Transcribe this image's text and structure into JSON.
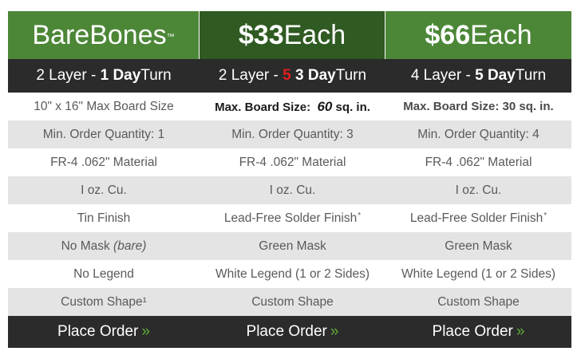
{
  "plans": [
    {
      "header": {
        "name": "BareBones",
        "tm": "™"
      },
      "turn": {
        "layers": "2 Layer - ",
        "days": "1 Day",
        "turn_word": " Turn"
      },
      "features": [
        "10\" x 16\" Max Board Size",
        "Min. Order Quantity:  1",
        "FR-4 .062\" Material",
        "I oz. Cu.",
        "Tin Finish",
        "No Mask",
        "No Legend",
        "Custom Shape¹"
      ],
      "mask_note": "(bare)",
      "order_label": "Place Order",
      "order_arrow": "»"
    },
    {
      "header": {
        "price": "$33",
        "unit": "Each"
      },
      "turn": {
        "layers": "2 Layer - ",
        "old_days": "5",
        "days": "3 Day",
        "turn_word": " Turn"
      },
      "board_size": {
        "label": "Max. Board Size: ",
        "value": "60",
        "unit": " sq. in."
      },
      "features": [
        "Min. Order Quantity:  3",
        "FR-4 .062\" Material",
        "I oz. Cu.",
        "Lead-Free Solder Finish",
        "Green Mask",
        "White Legend (1 or 2 Sides)",
        "Custom Shape"
      ],
      "finish_mark": "*",
      "order_label": "Place Order",
      "order_arrow": "»"
    },
    {
      "header": {
        "price": "$66",
        "unit": "Each"
      },
      "turn": {
        "layers": "4 Layer - ",
        "days": "5 Day",
        "turn_word": " Turn"
      },
      "board_size": {
        "label": "Max. Board Size: 30 sq. in."
      },
      "features": [
        "Min. Order Quantity:  4",
        "FR-4 .062\" Material",
        "I oz. Cu.",
        "Lead-Free Solder Finish",
        "Green Mask",
        "White Legend (1 or 2 Sides)",
        "Custom Shape"
      ],
      "finish_mark": "*",
      "order_label": "Place Order",
      "order_arrow": "»"
    }
  ],
  "colors": {
    "header_green": "#4c8737",
    "header_dark_green": "#2f5a22",
    "bar_dark": "#2b2b2b",
    "row_stripe": "#e4e4e4",
    "strike_red": "#e21f1f",
    "arrow_green": "#5fae3a"
  }
}
